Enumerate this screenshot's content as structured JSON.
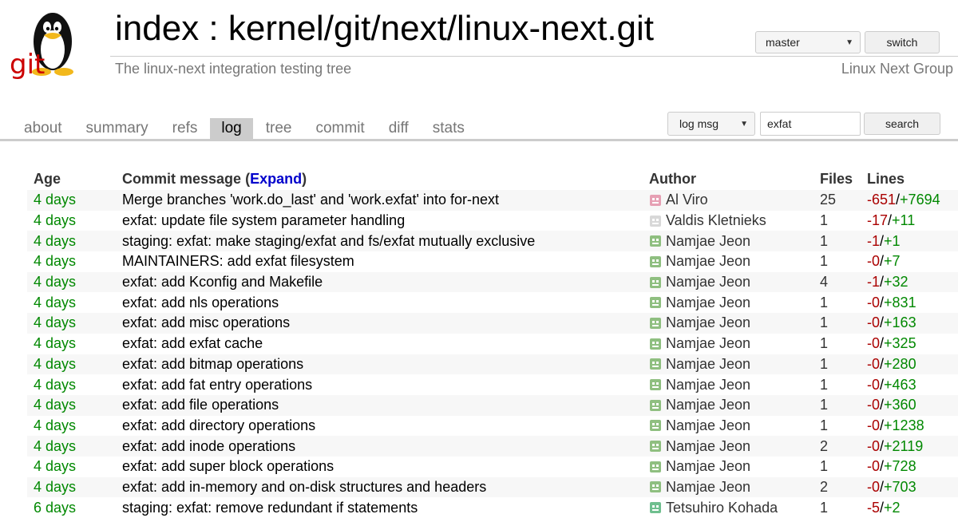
{
  "header": {
    "logo_text": "git",
    "title": "index : kernel/git/next/linux-next.git",
    "description": "The linux-next integration testing tree",
    "owner": "Linux Next Group",
    "branch": "master",
    "switch_label": "switch"
  },
  "tabs": [
    {
      "label": "about",
      "active": false
    },
    {
      "label": "summary",
      "active": false
    },
    {
      "label": "refs",
      "active": false
    },
    {
      "label": "log",
      "active": true
    },
    {
      "label": "tree",
      "active": false
    },
    {
      "label": "commit",
      "active": false
    },
    {
      "label": "diff",
      "active": false
    },
    {
      "label": "stats",
      "active": false
    }
  ],
  "search": {
    "scope": "log msg",
    "query": "exfat",
    "button_label": "search"
  },
  "log": {
    "headers": {
      "age": "Age",
      "message": "Commit message",
      "expand_open": "(",
      "expand": "Expand",
      "expand_close": ")",
      "author": "Author",
      "files": "Files",
      "lines": "Lines"
    },
    "rows": [
      {
        "age": "4 days",
        "message": "Merge branches 'work.do_last' and 'work.exfat' into for-next",
        "author": "Al Viro",
        "avatar_color": "#e6a0b4",
        "files": "25",
        "removed": "-651",
        "added": "+7694"
      },
      {
        "age": "4 days",
        "message": "exfat: update file system parameter handling",
        "author": "Valdis Kletnieks",
        "avatar_color": "#d8d8d8",
        "files": "1",
        "removed": "-17",
        "added": "+11"
      },
      {
        "age": "4 days",
        "message": "staging: exfat: make staging/exfat and fs/exfat mutually exclusive",
        "author": "Namjae Jeon",
        "avatar_color": "#8fbf80",
        "files": "1",
        "removed": "-1",
        "added": "+1"
      },
      {
        "age": "4 days",
        "message": "MAINTAINERS: add exfat filesystem",
        "author": "Namjae Jeon",
        "avatar_color": "#8fbf80",
        "files": "1",
        "removed": "-0",
        "added": "+7"
      },
      {
        "age": "4 days",
        "message": "exfat: add Kconfig and Makefile",
        "author": "Namjae Jeon",
        "avatar_color": "#8fbf80",
        "files": "4",
        "removed": "-1",
        "added": "+32"
      },
      {
        "age": "4 days",
        "message": "exfat: add nls operations",
        "author": "Namjae Jeon",
        "avatar_color": "#8fbf80",
        "files": "1",
        "removed": "-0",
        "added": "+831"
      },
      {
        "age": "4 days",
        "message": "exfat: add misc operations",
        "author": "Namjae Jeon",
        "avatar_color": "#8fbf80",
        "files": "1",
        "removed": "-0",
        "added": "+163"
      },
      {
        "age": "4 days",
        "message": "exfat: add exfat cache",
        "author": "Namjae Jeon",
        "avatar_color": "#8fbf80",
        "files": "1",
        "removed": "-0",
        "added": "+325"
      },
      {
        "age": "4 days",
        "message": "exfat: add bitmap operations",
        "author": "Namjae Jeon",
        "avatar_color": "#8fbf80",
        "files": "1",
        "removed": "-0",
        "added": "+280"
      },
      {
        "age": "4 days",
        "message": "exfat: add fat entry operations",
        "author": "Namjae Jeon",
        "avatar_color": "#8fbf80",
        "files": "1",
        "removed": "-0",
        "added": "+463"
      },
      {
        "age": "4 days",
        "message": "exfat: add file operations",
        "author": "Namjae Jeon",
        "avatar_color": "#8fbf80",
        "files": "1",
        "removed": "-0",
        "added": "+360"
      },
      {
        "age": "4 days",
        "message": "exfat: add directory operations",
        "author": "Namjae Jeon",
        "avatar_color": "#8fbf80",
        "files": "1",
        "removed": "-0",
        "added": "+1238"
      },
      {
        "age": "4 days",
        "message": "exfat: add inode operations",
        "author": "Namjae Jeon",
        "avatar_color": "#8fbf80",
        "files": "2",
        "removed": "-0",
        "added": "+2119"
      },
      {
        "age": "4 days",
        "message": "exfat: add super block operations",
        "author": "Namjae Jeon",
        "avatar_color": "#8fbf80",
        "files": "1",
        "removed": "-0",
        "added": "+728"
      },
      {
        "age": "4 days",
        "message": "exfat: add in-memory and on-disk structures and headers",
        "author": "Namjae Jeon",
        "avatar_color": "#8fbf80",
        "files": "2",
        "removed": "-0",
        "added": "+703"
      },
      {
        "age": "6 days",
        "message": "staging: exfat: remove redundant if statements",
        "author": "Tetsuhiro Kohada",
        "avatar_color": "#6fbf8f",
        "files": "1",
        "removed": "-5",
        "added": "+2"
      }
    ]
  }
}
